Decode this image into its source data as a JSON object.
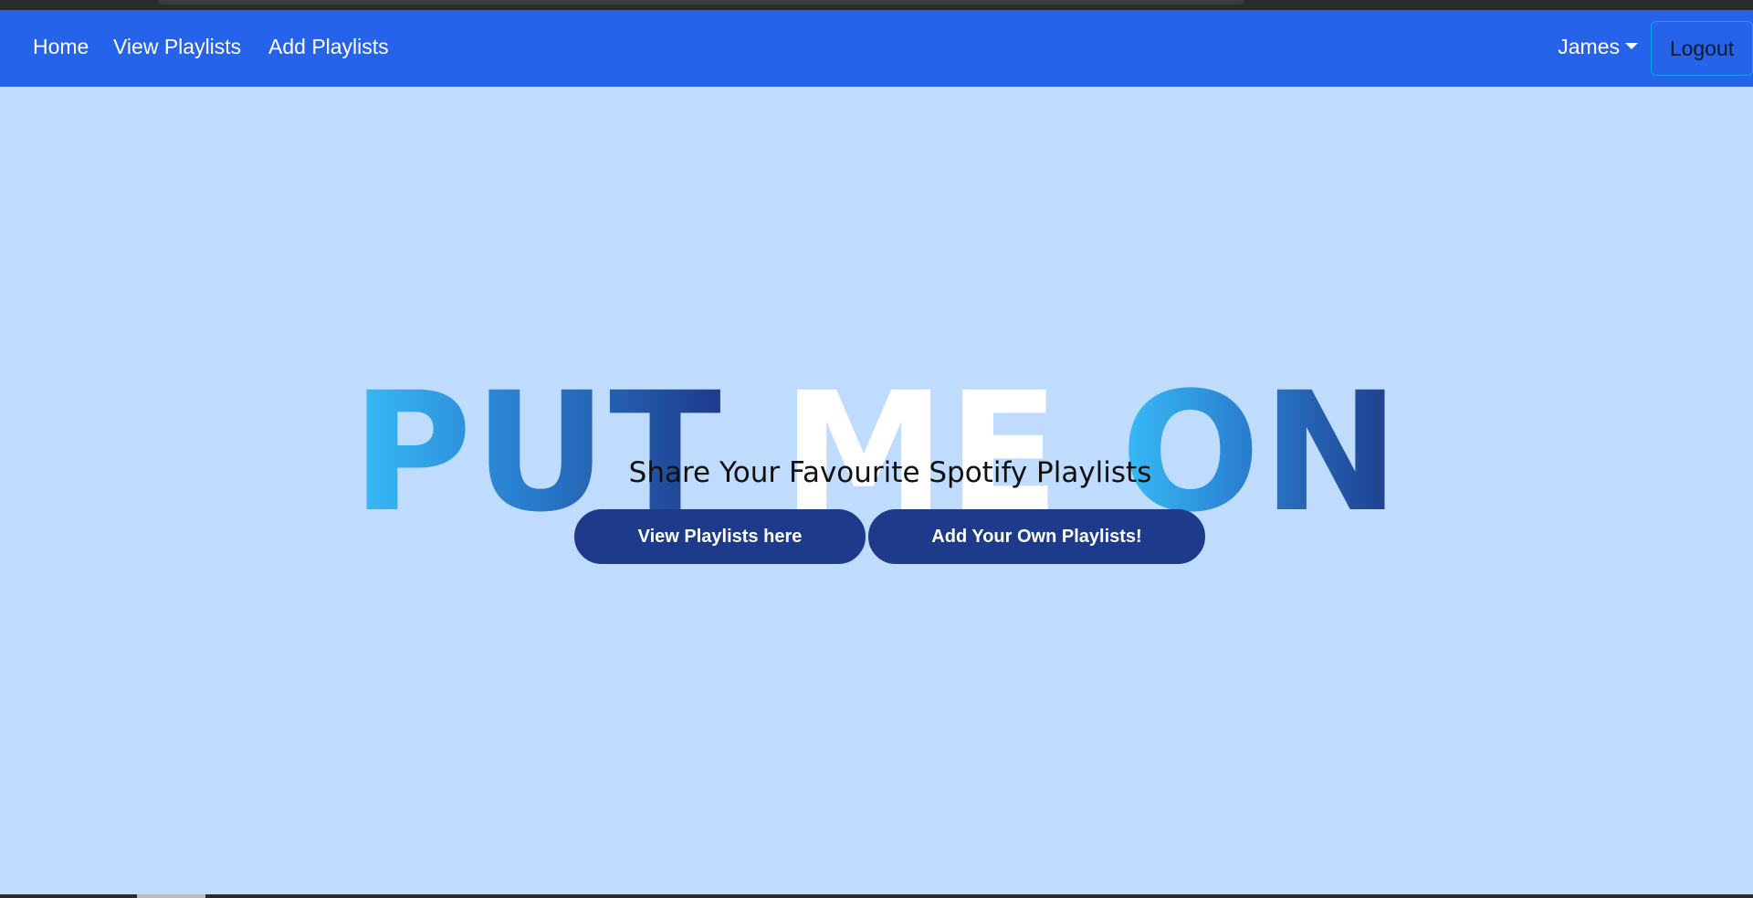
{
  "navbar": {
    "links": [
      {
        "label": "Home"
      },
      {
        "label": "View Playlists"
      },
      {
        "label": "Add Playlists"
      }
    ],
    "user": {
      "name": "James"
    },
    "logout_label": "Logout",
    "background_color": "#2563eb"
  },
  "hero": {
    "title_words": [
      "PUT",
      "ME",
      "ON"
    ],
    "tagline": "Share Your Favourite Spotify Playlists",
    "buttons": [
      {
        "label": "View Playlists here"
      },
      {
        "label": "Add Your Own Playlists!"
      }
    ],
    "gradient_colors": [
      "#38bdf8",
      "#1e3a8a"
    ],
    "button_color": "#1e3a8a"
  },
  "page": {
    "background_color": "#bfdbfe"
  }
}
